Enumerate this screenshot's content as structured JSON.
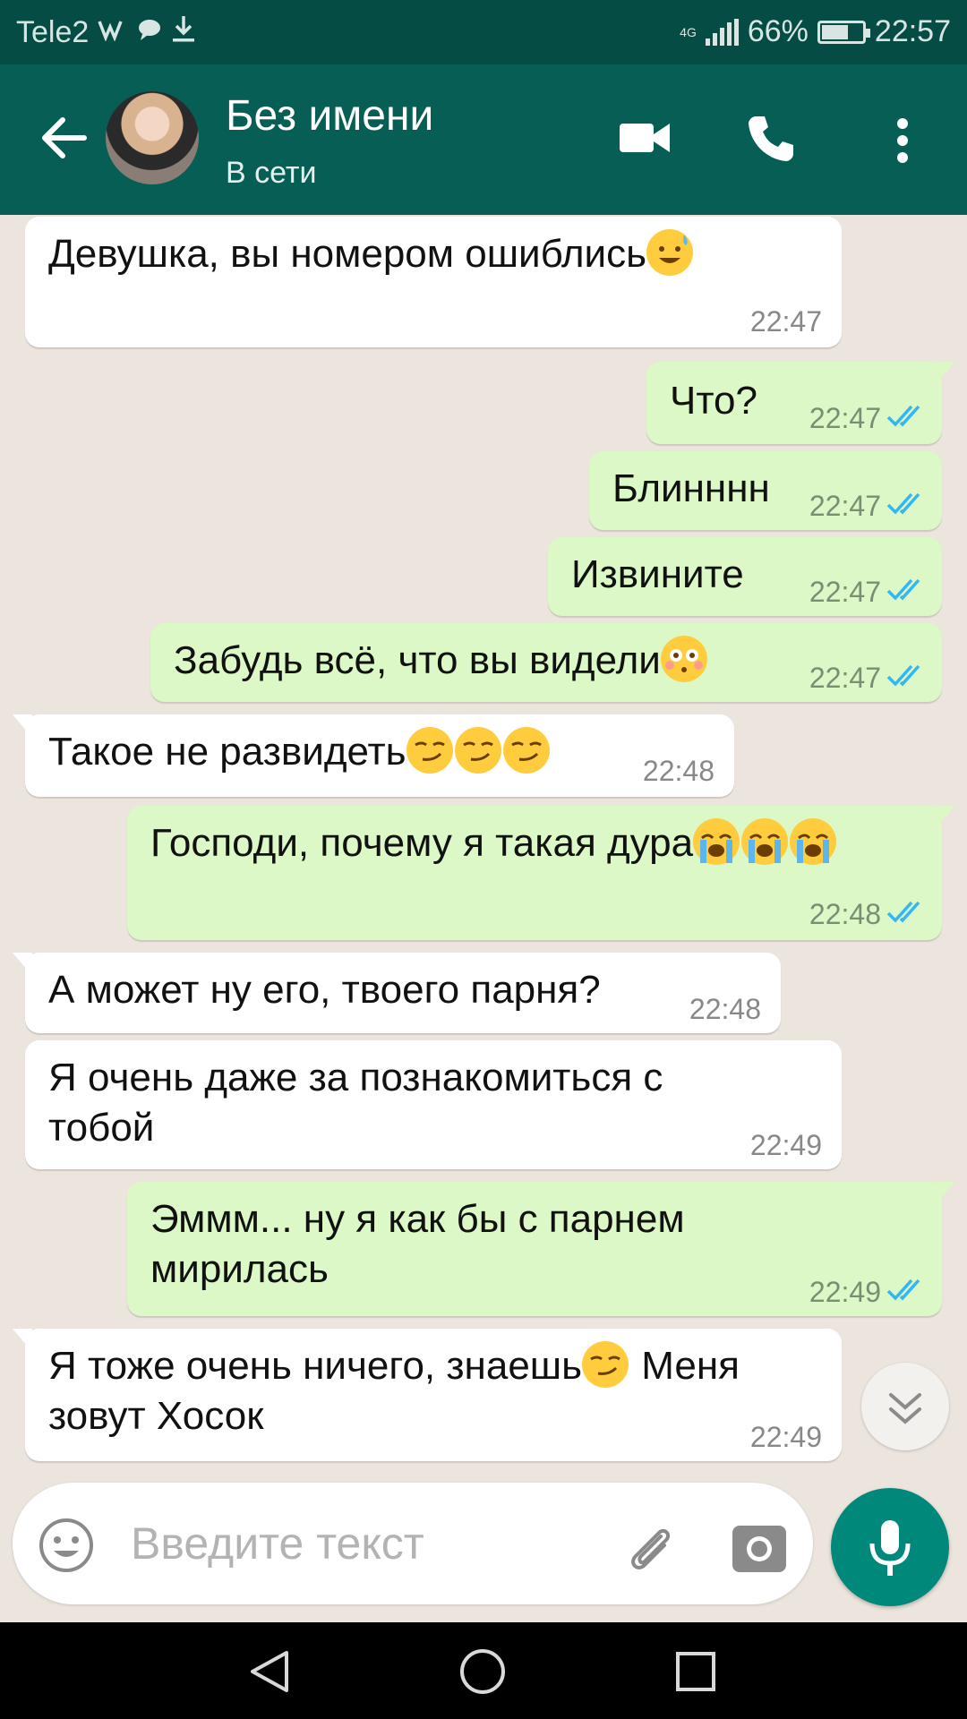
{
  "status_bar": {
    "carrier": "Tele2",
    "network": "4G",
    "battery": "66%",
    "battery_level": 0.66,
    "time": "22:57"
  },
  "header": {
    "contact_name": "Без имени",
    "status": "В сети"
  },
  "messages": [
    {
      "dir": "in",
      "text": "Девушка, вы номером ошиблись",
      "time": "22:47",
      "emoji": [
        "sweat-smile"
      ]
    },
    {
      "dir": "out",
      "text": "Что?",
      "time": "22:47"
    },
    {
      "dir": "out",
      "text": "Блинннн",
      "time": "22:47"
    },
    {
      "dir": "out",
      "text": "Извините",
      "time": "22:47"
    },
    {
      "dir": "out",
      "text": "Забудь всё, что вы видели",
      "time": "22:47",
      "emoji": [
        "flushed"
      ]
    },
    {
      "dir": "in",
      "text": "Такое не развидеть",
      "time": "22:48",
      "emoji": [
        "smirk",
        "smirk",
        "smirk"
      ]
    },
    {
      "dir": "out",
      "text": "Господи, почему я такая дура",
      "time": "22:48",
      "emoji": [
        "sob",
        "sob",
        "sob"
      ]
    },
    {
      "dir": "in",
      "text": "А может ну его, твоего парня?",
      "time": "22:48"
    },
    {
      "dir": "in",
      "text_line1": "Я очень даже за познакомиться с",
      "text_line2": "тобой",
      "time": "22:49"
    },
    {
      "dir": "out",
      "text_line1": "Эммм... ну я как бы с парнем",
      "text_line2": "мирилась",
      "time": "22:49"
    },
    {
      "dir": "in",
      "text_line1": "Я тоже очень ничего, знаешь",
      "text_line1b": " Меня",
      "text_line2": "зовут Хосок",
      "time": "22:49",
      "emoji": [
        "smirk"
      ]
    }
  ],
  "input": {
    "placeholder": "Введите текст"
  },
  "colors": {
    "header": "#075e54",
    "status_bar": "#054d44",
    "outgoing_bubble": "#dcf8c6",
    "incoming_bubble": "#ffffff",
    "read_ticks": "#34b7f1",
    "mic_button": "#00897b"
  },
  "icons": [
    "back-arrow-icon",
    "video-call-icon",
    "phone-icon",
    "more-vert-icon",
    "emoji-icon",
    "attach-icon",
    "camera-icon",
    "mic-icon",
    "scroll-down-icon",
    "nav-back-icon",
    "nav-home-icon",
    "nav-recent-icon"
  ]
}
